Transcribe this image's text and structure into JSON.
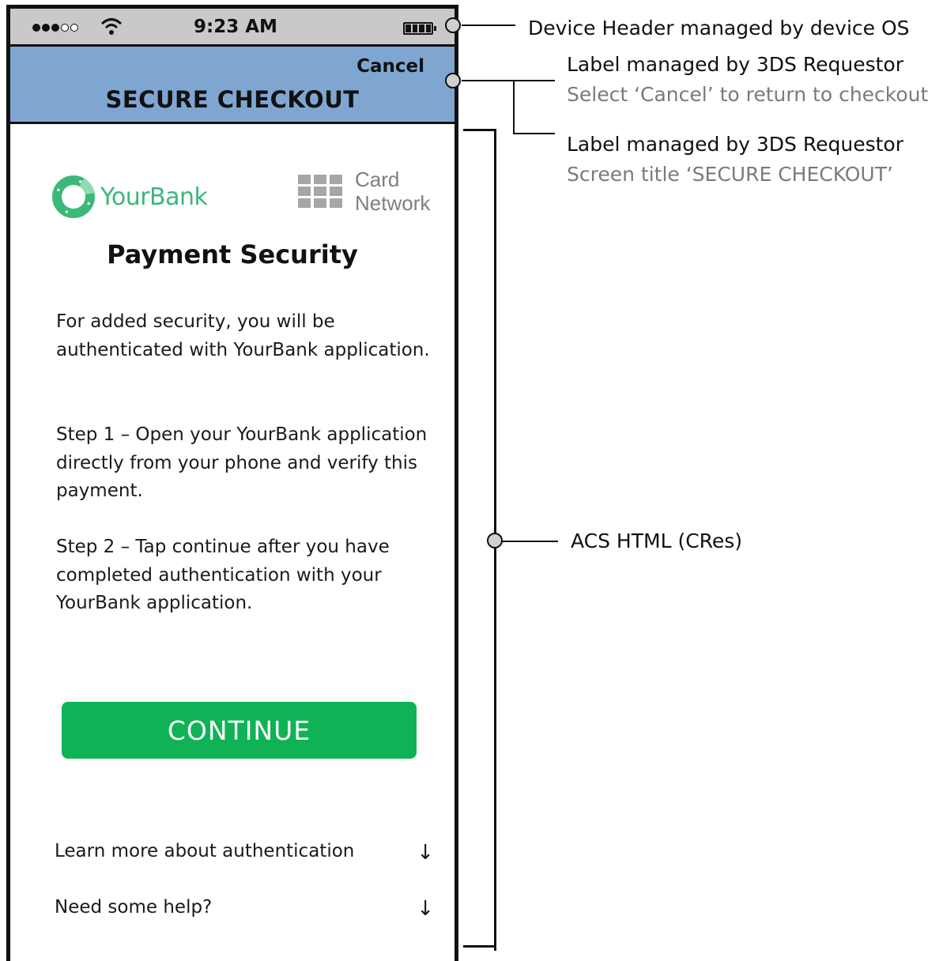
{
  "status_bar": {
    "time": "9:23 AM",
    "signal_icon": "signal-dots-icon",
    "wifi_icon": "wifi-icon",
    "battery_icon": "battery-icon"
  },
  "nav_bar": {
    "cancel": "Cancel",
    "title": "SECURE CHECKOUT"
  },
  "logos": {
    "bank_name": "YourBank",
    "card_line1": "Card",
    "card_line2": "Network"
  },
  "content": {
    "title": "Payment Security",
    "paragraphs": [
      "For added security, you will be authenticated with YourBank application.",
      "Step 1 – Open your YourBank application directly from your phone and verify this payment.",
      "Step 2 – Tap continue after you have completed authentication with your YourBank application."
    ],
    "continue_label": "CONTINUE",
    "expandables": [
      {
        "label": "Learn more about authentication",
        "icon": "arrow-down-icon",
        "arrow": "↓"
      },
      {
        "label": "Need some help?",
        "icon": "arrow-down-icon",
        "arrow": "↓"
      }
    ]
  },
  "annotations": {
    "device_header": "Device Header managed by device OS",
    "cancel_label_title": "Label managed by 3DS Requestor",
    "cancel_label_desc": "Select ‘Cancel’ to return to checkout",
    "title_label_title": "Label managed by 3DS Requestor",
    "title_label_desc": "Screen title ‘SECURE CHECKOUT’",
    "acs_html": "ACS HTML (CRes)"
  },
  "colors": {
    "status_bar": "#c9c9c9",
    "nav_bar": "#7fa6d1",
    "continue_button": "#10b256",
    "bank_green": "#3bb87a",
    "card_gray": "#a6a6a6",
    "annotation_sub": "#7a7a7a"
  }
}
